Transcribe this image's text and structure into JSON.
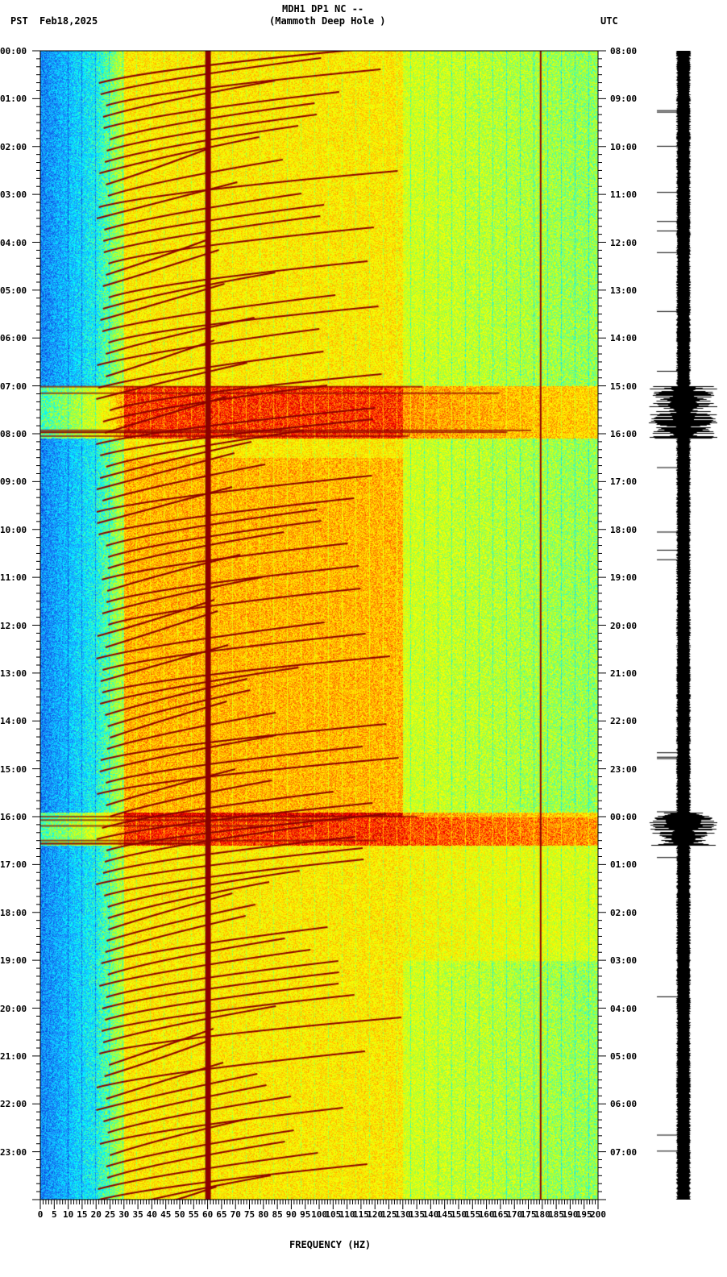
{
  "header": {
    "station": "MDH1 DP1 NC --",
    "location": "(Mammoth Deep Hole )",
    "left_tz": "PST",
    "date": "Feb18,2025",
    "right_tz": "UTC"
  },
  "chart_data": {
    "type": "heatmap",
    "title": "MDH1 DP1 NC -- (Mammoth Deep Hole )",
    "xlabel": "FREQUENCY (HZ)",
    "ylabel_left": "PST",
    "ylabel_right": "UTC",
    "xlim": [
      0,
      200
    ],
    "ylim_hours": [
      0,
      24
    ],
    "x_ticks": [
      "0",
      "5",
      "10",
      "15",
      "20",
      "25",
      "30",
      "35",
      "40",
      "45",
      "50",
      "55",
      "60",
      "65",
      "70",
      "75",
      "80",
      "85",
      "90",
      "95",
      "100",
      "105",
      "110",
      "115",
      "120",
      "125",
      "130",
      "135",
      "140",
      "145",
      "150",
      "155",
      "160",
      "165",
      "170",
      "175",
      "180",
      "185",
      "190",
      "195",
      "200"
    ],
    "left_time_ticks": [
      "00:00",
      "01:00",
      "02:00",
      "03:00",
      "04:00",
      "05:00",
      "06:00",
      "07:00",
      "08:00",
      "09:00",
      "10:00",
      "11:00",
      "12:00",
      "13:00",
      "14:00",
      "15:00",
      "16:00",
      "17:00",
      "18:00",
      "19:00",
      "20:00",
      "21:00",
      "22:00",
      "23:00"
    ],
    "right_time_ticks": [
      "08:00",
      "09:00",
      "10:00",
      "11:00",
      "12:00",
      "13:00",
      "14:00",
      "15:00",
      "16:00",
      "17:00",
      "18:00",
      "19:00",
      "20:00",
      "21:00",
      "22:00",
      "23:00",
      "00:00",
      "01:00",
      "02:00",
      "03:00",
      "04:00",
      "05:00",
      "06:00",
      "07:00"
    ],
    "persistent_lines_hz": [
      60,
      180
    ],
    "event_bands_hours": [
      [
        7.0,
        8.1
      ],
      [
        15.9,
        16.6
      ]
    ],
    "colormap": [
      "#0033cc",
      "#1e90ff",
      "#00ffff",
      "#adff2f",
      "#ffff00",
      "#ffa500",
      "#ff0000",
      "#8b0000"
    ]
  }
}
